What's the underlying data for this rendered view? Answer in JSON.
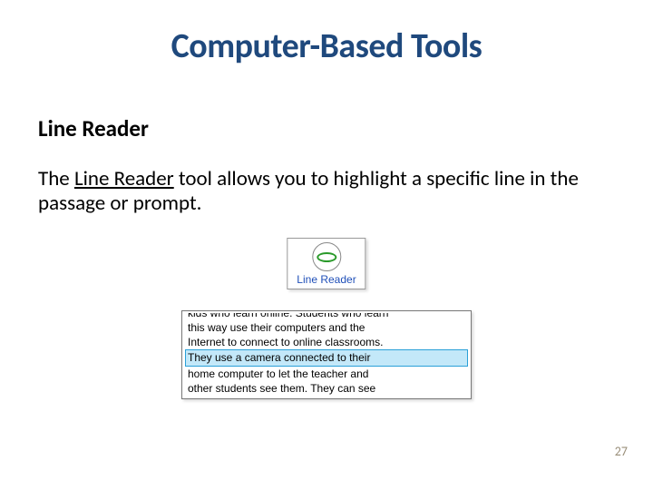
{
  "title": "Computer-Based Tools",
  "subtitle": "Line Reader",
  "body": {
    "prefix": "The ",
    "underlined": "Line Reader",
    "suffix": " tool allows you to highlight a specific line in the passage or prompt."
  },
  "tool_button": {
    "label": "Line Reader",
    "icon_name": "line-reader-icon"
  },
  "passage": {
    "cut_top": "kids who learn online. Students who learn",
    "lines": [
      "this way use their computers and the",
      "Internet to connect to online classrooms.",
      "They use a camera connected to their",
      "home computer to let the teacher and",
      "other students see them. They can see"
    ],
    "highlight_index": 2
  },
  "page_number": "27"
}
